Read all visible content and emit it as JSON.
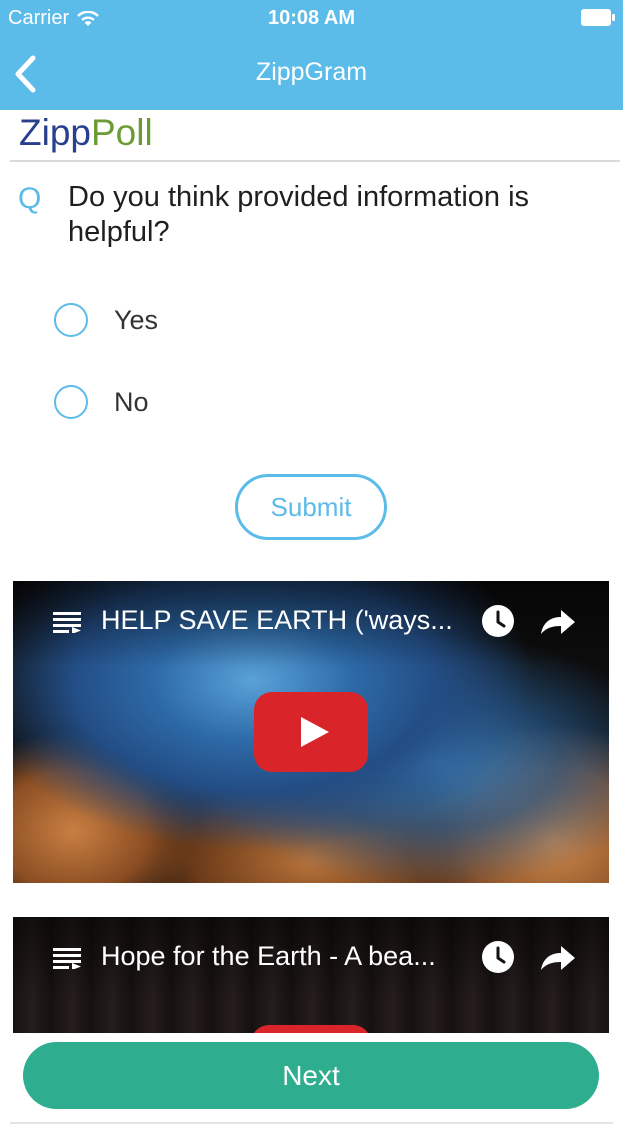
{
  "status_bar": {
    "carrier": "Carrier",
    "time": "10:08 AM"
  },
  "nav": {
    "title": "ZippGram",
    "back_icon": "chevron-left-icon"
  },
  "brand": {
    "part1": "Zipp",
    "part2": "Poll",
    "color_part1": "#283f8f",
    "color_part2": "#6c9b34"
  },
  "question": {
    "marker": "Q",
    "text": "Do you think provided information is helpful?"
  },
  "options": [
    {
      "label": "Yes"
    },
    {
      "label": "No"
    }
  ],
  "submit": {
    "label": "Submit"
  },
  "videos": [
    {
      "title": "HELP SAVE EARTH ('ways..."
    },
    {
      "title": "Hope for the Earth - A bea..."
    }
  ],
  "next": {
    "label": "Next"
  },
  "colors": {
    "accent": "#5bbbe9",
    "primary_button": "#2eae8e",
    "play": "#d9252a"
  }
}
